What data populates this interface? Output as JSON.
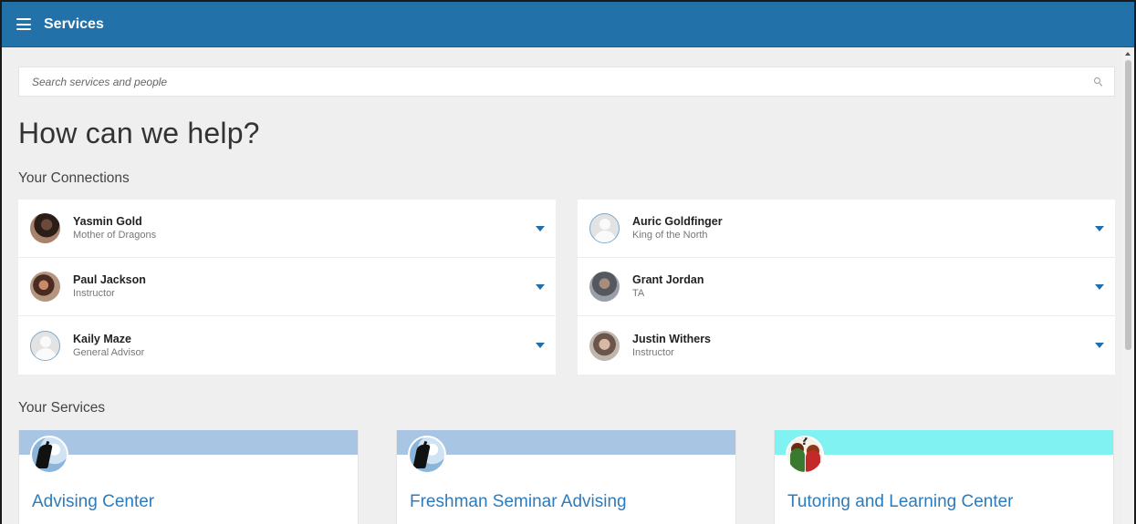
{
  "header": {
    "title": "Services",
    "menu_icon": "hamburger-menu-icon"
  },
  "search": {
    "placeholder": "Search services and people",
    "value": "",
    "icon": "search-icon"
  },
  "page_title": "How can we help?",
  "connections": {
    "heading": "Your Connections",
    "left": [
      {
        "name": "Yasmin Gold",
        "role": "Mother of Dragons",
        "avatar": "photo"
      },
      {
        "name": "Paul Jackson",
        "role": "Instructor",
        "avatar": "photo"
      },
      {
        "name": "Kaily Maze",
        "role": "General Advisor",
        "avatar": "placeholder"
      }
    ],
    "right": [
      {
        "name": "Auric Goldfinger",
        "role": "King of the North",
        "avatar": "placeholder"
      },
      {
        "name": "Grant Jordan",
        "role": "TA",
        "avatar": "photo"
      },
      {
        "name": "Justin Withers",
        "role": "Instructor",
        "avatar": "photo"
      }
    ]
  },
  "services": {
    "heading": "Your Services",
    "items": [
      {
        "title": "Advising Center",
        "banner_color": "#a8c5e3",
        "emblem": "rock-climber-icon"
      },
      {
        "title": "Freshman Seminar Advising",
        "banner_color": "#a8c5e3",
        "emblem": "rock-climber-icon"
      },
      {
        "title": "Tutoring and Learning Center",
        "banner_color": "#7ff2f1",
        "emblem": "students-question-icon"
      }
    ]
  },
  "colors": {
    "accent": "#2271a8",
    "link": "#2b7bbd",
    "background": "#efefef"
  }
}
